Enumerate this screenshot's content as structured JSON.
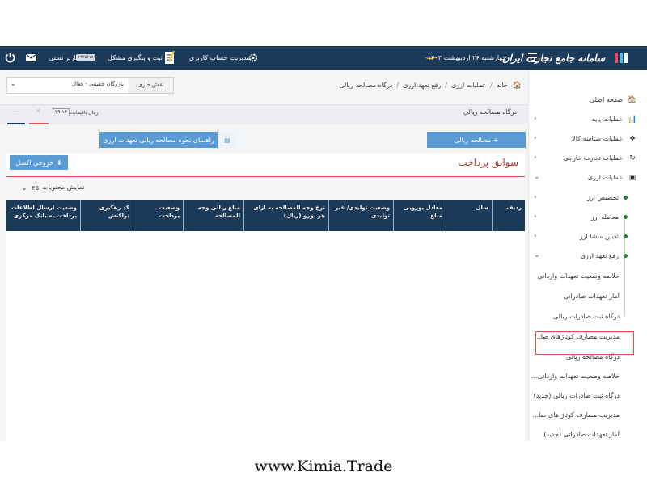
{
  "topbar": {
    "logo_text": "سامانه جامع تجارت ایران",
    "date": "چهارشنبه ۲۶ اردیبهشت ۱۴۰۳",
    "account": "مدیریت حساب کاربری",
    "issue": "ثبت و پیگیری مشکل",
    "user_badge": "۱۲۳۴۵۶۷۸۹",
    "user_name": "کاربر تستی"
  },
  "sidebar": {
    "items": [
      {
        "label": "صفحه اصلی",
        "icon": "home-icon",
        "glyph": "🏠"
      },
      {
        "label": "عملیات پایه",
        "icon": "chart-icon",
        "glyph": "📊"
      },
      {
        "label": "عملیات شناسه کالا",
        "icon": "cubes-icon",
        "glyph": "❖"
      },
      {
        "label": "عملیات تجارت خارجی",
        "icon": "refresh-icon",
        "glyph": "↻"
      },
      {
        "label": "عملیات ارزی",
        "icon": "money-icon",
        "glyph": "▣"
      }
    ],
    "sub_items": [
      "تخصیص ارز",
      "معامله ارز",
      "تعیین منشا ارز",
      "رفع تعهد ارزی"
    ],
    "sub_sub_items": [
      "خلاصه وضعیت تعهدات وارداتی",
      "آمار تعهدات صادراتی",
      "درگاه ثبت صادرات ریالی",
      "مدیریت مصارف کوتاژهای صا...",
      "درگاه مصالحه ریالی",
      "خلاصه وضعیت تعهدات وارداتی...",
      "درگاه ثبت صادرات ریالی (جدید)",
      "مدیریت مصارف کوتاژ های صا...",
      "آمار تعهدات صادراتی (جدید)"
    ]
  },
  "breadcrumb": [
    "خانه",
    "عملیات ارزی",
    "رفع تعهد ارزی",
    "درگاه مصالحه ریالی"
  ],
  "role": {
    "label": "نقش جاری",
    "value": "بازرگان حقیقی - فعال"
  },
  "tab": {
    "title": "درگاه مصالحه ریالی",
    "timer_label": "زمان باقیمانده",
    "timer_value": "۲۹:۱۴"
  },
  "buttons": {
    "reconcile": "+ مصالحه ریالی",
    "guide": "راهنمای نحوه مصالحه ریالی تعهدات ارزی",
    "excel": "خروجی اکسل"
  },
  "history": {
    "title": "سوابق پرداخت"
  },
  "page_size": {
    "label": "نمایش محتویات",
    "value": "۲۵"
  },
  "table": {
    "columns": [
      "ردیف",
      "سال",
      "معادل یورویی مبلغ",
      "وضعیت تولیدی/ غیر تولیدی",
      "نرخ وجه المصالحه به ازای هر یورو (ریال)",
      "مبلغ ریالی وجه المصالحه",
      "وضعیت پرداخت",
      "کد رهگیری تراکنش",
      "وضعیت ارسال اطلاعات پرداخت به بانک مرکزی"
    ]
  },
  "footer": {
    "url": "www.Kimia.Trade"
  },
  "colors": {
    "header": "#1c3b5a",
    "button": "#5b9bd5",
    "accent_red": "#d9534f",
    "active_dot": "#2e7d32"
  }
}
